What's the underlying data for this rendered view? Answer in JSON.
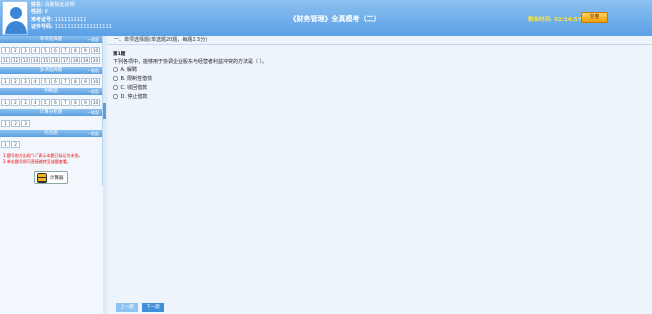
{
  "header": {
    "info": [
      {
        "label": "姓名:",
        "value": "请删除此说明"
      },
      {
        "label": "性别:",
        "value": "8"
      },
      {
        "label": "准考证号:",
        "value": "1111111111"
      },
      {
        "label": "证件号码:",
        "value": "111111111111111111"
      }
    ],
    "title": "《财务管理》全真模考（二）",
    "timer_label": "剩余时间:",
    "timer_value": "02:14:57",
    "submit_label": "交卷"
  },
  "sidebar": {
    "sections": [
      {
        "title": "单项选择题",
        "collapse": "一收起",
        "rows": [
          [
            "1",
            "2",
            "3",
            "4",
            "5",
            "6",
            "7",
            "8",
            "9",
            "10"
          ],
          [
            "11",
            "12",
            "13",
            "14",
            "15",
            "16",
            "17",
            "18",
            "19",
            "20"
          ]
        ]
      },
      {
        "title": "多项选择题",
        "collapse": "一收起",
        "rows": [
          [
            "1",
            "2",
            "3",
            "4",
            "5",
            "6",
            "7",
            "8",
            "9",
            "10"
          ]
        ]
      },
      {
        "title": "判断题",
        "collapse": "一收起",
        "rows": [
          [
            "1",
            "2",
            "3",
            "4",
            "5",
            "6",
            "7",
            "8",
            "9",
            "10"
          ]
        ]
      },
      {
        "title": "计算分析题",
        "collapse": "一收起",
        "rows": [
          [
            "1",
            "2",
            "3"
          ]
        ]
      },
      {
        "title": "综合题",
        "collapse": "一收起",
        "rows": [
          [
            "1",
            "2"
          ]
        ]
      }
    ],
    "notes": [
      "1.题号前方出现“☐”表示本题已标记为未答。",
      "2.单击题号即可直接跳转至该题查看。"
    ],
    "calc_label": "计算器"
  },
  "main": {
    "section_title": "一、单项选择题(单选题20题，每题2.5分)",
    "question_number": "第1题",
    "question_text": "下列各项中，能够用于协调企业股东与经营者利益冲突的方法是（  ）。",
    "options": [
      {
        "key": "A.",
        "text": "解聘"
      },
      {
        "key": "B.",
        "text": "限制性借债"
      },
      {
        "key": "C.",
        "text": "收回借款"
      },
      {
        "key": "D.",
        "text": "停止借款"
      }
    ],
    "prev_label": "上一题",
    "next_label": "下一题"
  },
  "colors": {
    "header": "#5aa0e6",
    "timer": "#ffe23a",
    "submit": "#f0a000",
    "accent": "#3f8fdc",
    "note": "#e00000"
  }
}
